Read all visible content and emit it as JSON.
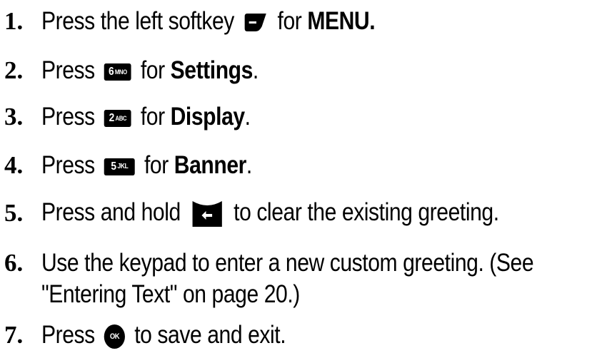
{
  "steps": [
    {
      "num": "1.",
      "pre": "Press the left softkey",
      "key": "softkey-left",
      "post": "for",
      "bold": "MENU."
    },
    {
      "num": "2.",
      "pre": "Press",
      "key": "6MNO",
      "post": "for",
      "bold": "Settings",
      "tail": "."
    },
    {
      "num": "3.",
      "pre": "Press",
      "key": "2ABC",
      "post": "for",
      "bold": "Display",
      "tail": "."
    },
    {
      "num": "4.",
      "pre": "Press",
      "key": "5JKL",
      "post": "for",
      "bold": "Banner",
      "tail": "."
    },
    {
      "num": "5.",
      "pre": "Press and hold",
      "key": "clear-back",
      "post": "to clear the existing greeting."
    },
    {
      "num": "6.",
      "line1": "Use the keypad to enter a new custom greeting. (See",
      "line2": "\"Entering Text\" on page 20.)"
    },
    {
      "num": "7.",
      "pre": "Press",
      "key": "OK",
      "post": "to save and exit."
    }
  ],
  "keys": {
    "six_digit": "6",
    "six_letters": "MNO",
    "two_digit": "2",
    "two_letters": "ABC",
    "five_digit": "5",
    "five_letters": "JKL",
    "ok_label": "OK"
  }
}
